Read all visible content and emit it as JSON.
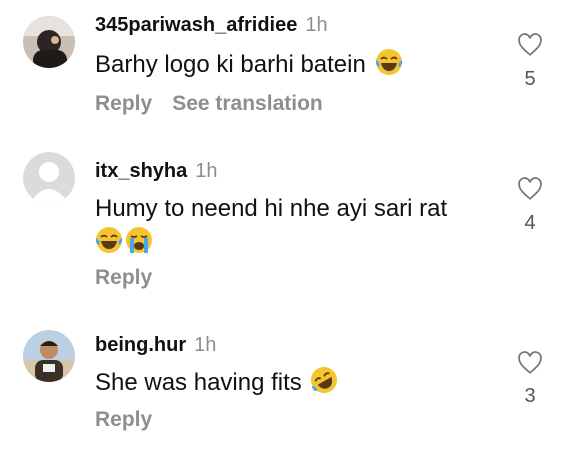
{
  "comments": [
    {
      "username": "345pariwash_afridiee",
      "time": "1h",
      "text": "Barhy logo ki barhi batein",
      "emojis": [
        "joy-emoji"
      ],
      "actions": {
        "reply": "Reply",
        "translate": "See translation"
      },
      "likes": "5"
    },
    {
      "username": "itx_shyha",
      "time": "1h",
      "text_line1": "Humy to neend hi nhe ayi sari rat",
      "emojis": [
        "joy-emoji",
        "crying-emoji"
      ],
      "actions": {
        "reply": "Reply"
      },
      "likes": "4"
    },
    {
      "username": "being.hur",
      "time": "1h",
      "text": "She was having fits",
      "emojis": [
        "rofl-emoji"
      ],
      "actions": {
        "reply": "Reply"
      },
      "likes": "3"
    }
  ]
}
